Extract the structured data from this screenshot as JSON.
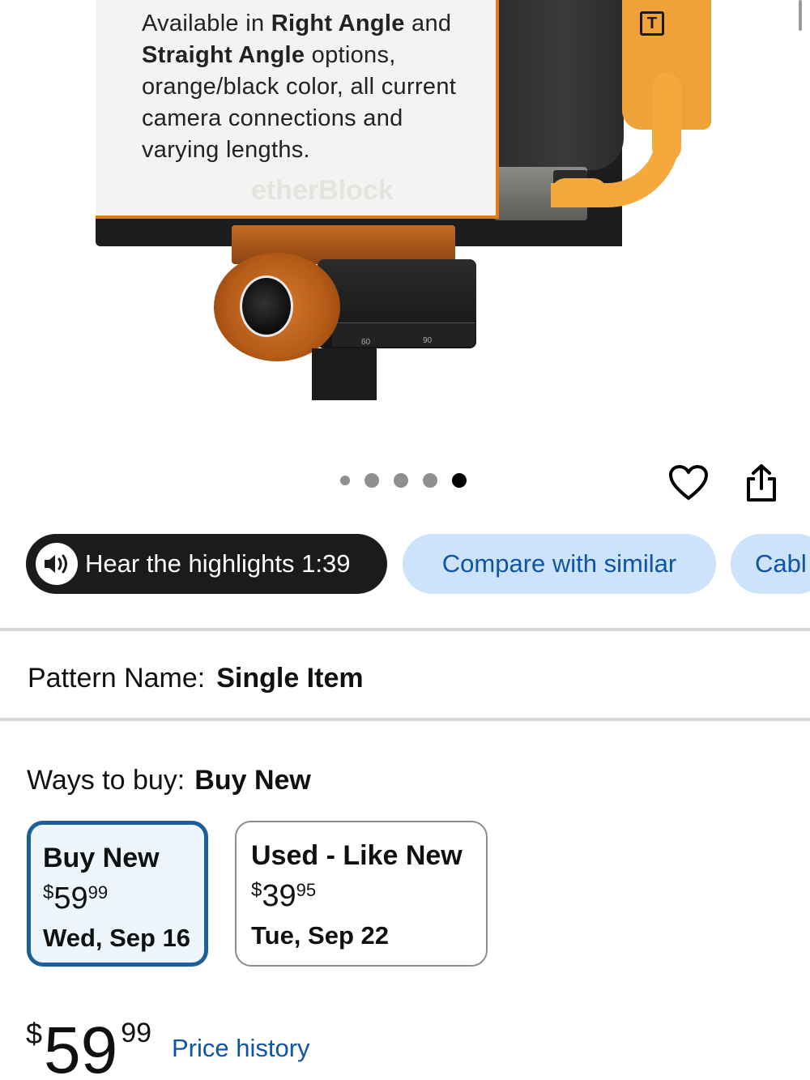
{
  "product_image": {
    "callout_text_parts": [
      {
        "text": "Available in ",
        "bold": false
      },
      {
        "text": "Right Angle",
        "bold": true
      },
      {
        "text": " and ",
        "bold": false
      },
      {
        "text": "Straight Angle",
        "bold": true
      },
      {
        "text": " options, orange/black color, all current camera connections and varying lengths.",
        "bold": false
      }
    ],
    "brand_watermark": "etherBlock",
    "device_logo_letter": "T",
    "scale_ticks": [
      "60",
      "90"
    ]
  },
  "carousel": {
    "total": 5,
    "active_index": 4
  },
  "actions": {
    "favorite_icon": "heart-icon",
    "share_icon": "share-icon"
  },
  "pills": {
    "hear": {
      "label": "Hear the highlights 1:39",
      "icon": "speaker-icon"
    },
    "compare": {
      "label": "Compare with similar"
    },
    "cable": {
      "label": "Cabl"
    }
  },
  "pattern": {
    "label": "Pattern Name:",
    "value": "Single Item"
  },
  "ways_to_buy": {
    "label": "Ways to buy:",
    "value": "Buy New",
    "options": [
      {
        "title": "Buy New",
        "currency": "$",
        "whole": "59",
        "cents": "99",
        "date": "Wed, Sep 16",
        "selected": true
      },
      {
        "title": "Used - Like New",
        "currency": "$",
        "whole": "39",
        "cents": "95",
        "date": "Tue, Sep 22",
        "selected": false
      }
    ]
  },
  "price": {
    "currency": "$",
    "whole": "59",
    "cents": "99",
    "history_link": "Price history"
  },
  "colors": {
    "accent_blue": "#0f55a5",
    "pill_blue_bg": "#cde2fb",
    "selected_border": "#1e5e99",
    "tether_orange": "#f5a83c"
  }
}
